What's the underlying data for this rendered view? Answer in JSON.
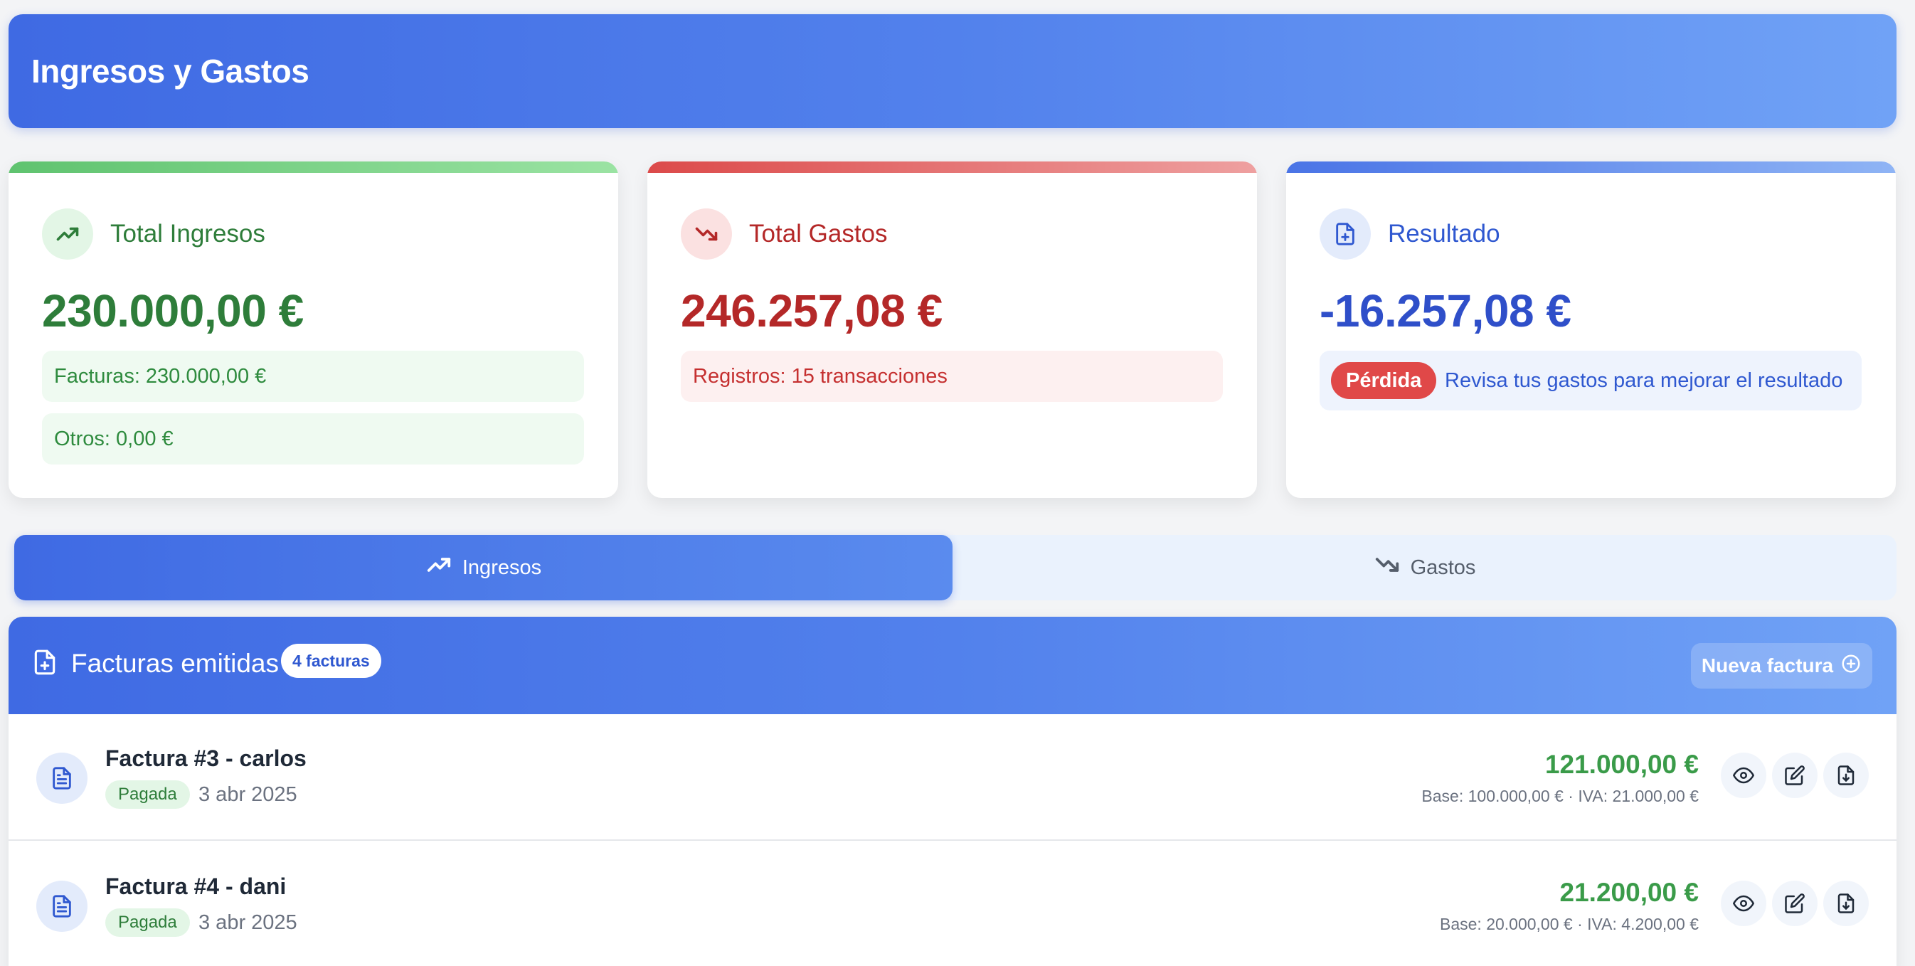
{
  "header": {
    "title": "Ingresos y Gastos"
  },
  "summary": {
    "income": {
      "title": "Total Ingresos",
      "amount": "230.000,00 €",
      "invoices": "Facturas: 230.000,00 €",
      "others": "Otros: 0,00 €",
      "icon": "trending-up-icon",
      "color": "#2e7d3a"
    },
    "expenses": {
      "title": "Total Gastos",
      "amount": "246.257,08 €",
      "records": "Registros: 15 transacciones",
      "icon": "trending-down-icon",
      "color": "#b42828"
    },
    "result": {
      "title": "Resultado",
      "amount": "-16.257,08 €",
      "badge": "Pérdida",
      "message": "Revisa tus gastos para mejorar el resultado",
      "icon": "file-plus-icon",
      "color": "#2f4fc9"
    }
  },
  "tabs": [
    {
      "label": "Ingresos",
      "icon": "trending-up-icon",
      "active": true
    },
    {
      "label": "Gastos",
      "icon": "trending-down-icon",
      "active": false
    }
  ],
  "invoices": {
    "title": "Facturas emitidas",
    "count": "4 facturas",
    "new_button": "Nueva factura",
    "rows": [
      {
        "title": "Factura #3 - carlos",
        "status": "Pagada",
        "date": "3 abr 2025",
        "amount": "121.000,00 €",
        "base": "Base: 100.000,00 € · IVA: 21.000,00 €"
      },
      {
        "title": "Factura #4 - dani",
        "status": "Pagada",
        "date": "3 abr 2025",
        "amount": "21.200,00 €",
        "base": "Base: 20.000,00 € · IVA: 4.200,00 €"
      }
    ]
  },
  "colors": {
    "accent": "#3f6ae3",
    "income": "#3a9b49",
    "expense": "#b42828",
    "loss_badge": "#e04848"
  }
}
